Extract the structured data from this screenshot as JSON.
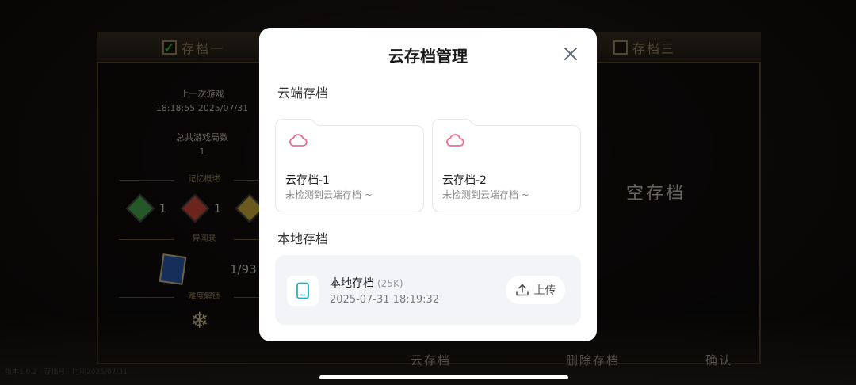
{
  "background": {
    "slot_tabs": [
      {
        "label": "存档一",
        "checked": true
      },
      {
        "label": "存档三",
        "checked": false
      }
    ],
    "last_game_label": "上一次游戏",
    "last_game_time": "18:18:55 2025/07/31",
    "total_games_label": "总共游戏局数",
    "total_games": "1",
    "memory_section": "记忆概述",
    "gems": [
      {
        "color": "#4caf50",
        "count": "1"
      },
      {
        "color": "#d84a3a",
        "count": "1"
      },
      {
        "color": "#d4b43a",
        "count": ""
      }
    ],
    "codex_section": "异闻录",
    "codex_progress": "1/93",
    "difficulty_section": "难度解锁",
    "empty_slot": "空存档",
    "bottom_buttons": [
      "云存档",
      "删除存档",
      "确认"
    ],
    "version_text": "版本1.0.2 · 存档号 · 时间2025/07/31"
  },
  "modal": {
    "title": "云存档管理",
    "cloud_section": "云端存档",
    "cloud_slots": [
      {
        "name": "云存档-1",
        "status": "未检测到云端存档 ~"
      },
      {
        "name": "云存档-2",
        "status": "未检测到云端存档 ~"
      }
    ],
    "local_section": "本地存档",
    "local": {
      "name": "本地存档",
      "size": "(25K)",
      "time": "2025-07-31 18:19:32",
      "upload_label": "上传"
    }
  },
  "colors": {
    "cloud_icon": "#f06b8e",
    "device_icon": "#1cb5c8"
  }
}
